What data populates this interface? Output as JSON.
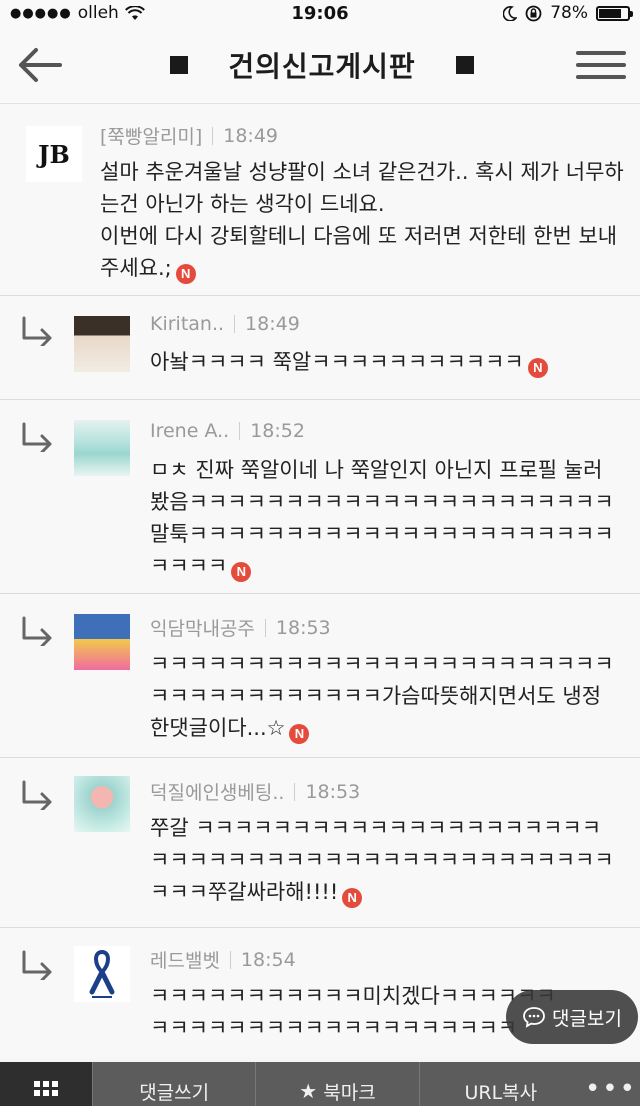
{
  "status_bar": {
    "carrier": "olleh",
    "time": "19:06",
    "battery": "78%",
    "battery_level": 0.78
  },
  "header": {
    "title": "건의신고게시판"
  },
  "comments": [
    {
      "author": "[쭉빵알리미]",
      "time": "18:49",
      "text": "설마 추운겨울날 성냥팔이 소녀 같은건가.. 혹시 제가 너무하는건 아닌가 하는 생각이 드네요.\n이번에 다시 강퇴할테니 다음에 또 저러면 저한테 한번 보내주세요.;",
      "badge": "N",
      "avatar_text": "JB"
    },
    {
      "author": "Kiritan..",
      "time": "18:49",
      "text": "아놬ㅋㅋㅋㅋ 쭉알ㅋㅋㅋㅋㅋㅋㅋㅋㅋㅋㅋ",
      "badge": "N"
    },
    {
      "author": "Irene A..",
      "time": "18:52",
      "text": "ㅁㅊ 진짜 쭉알이네 나 쭉알인지 아닌지 프로필 눌러봤음ㅋㅋㅋㅋㅋㅋㅋㅋㅋㅋㅋㅋㅋㅋㅋㅋㅋㅋㅋㅋㅋㅋ말툭ㅋㅋㅋㅋㅋㅋㅋㅋㅋㅋㅋㅋㅋㅋㅋㅋㅋㅋㅋㅋㅋㅋ ㅋㅋㅋㅋ",
      "badge": "N"
    },
    {
      "author": "익담막내공주",
      "time": "18:53",
      "text": "ㅋㅋㅋㅋㅋㅋㅋㅋㅋㅋㅋㅋㅋㅋㅋㅋㅋㅋㅋㅋㅋㅋㅋㅋㅋㅋㅋㅋㅋㅋㅋㅋㅋㅋㅋㅋ가슴따뜻해지면서도 냉정한댓글이다...☆",
      "badge": "N"
    },
    {
      "author": "덕질에인생베팅..",
      "time": "18:53",
      "text": "쭈갈 ㅋㅋㅋㅋㅋㅋㅋㅋㅋㅋㅋㅋㅋㅋㅋㅋㅋㅋㅋㅋㅋㅋㅋㅋㅋㅋㅋㅋㅋㅋㅋㅋㅋㅋㅋㅋㅋㅋㅋㅋㅋㅋㅋㅋㅋㅋㅋㅋ쭈갈싸라해!!!!",
      "badge": "N"
    },
    {
      "author": "레드밸벳",
      "time": "18:54",
      "text": "ㅋㅋㅋㅋㅋㅋㅋㅋㅋㅋㅋ미치겠다ㅋㅋㅋㅋㅋㅋ\nㅋㅋㅋㅋㅋㅋㅋㅋㅋㅋㅋㅋㅋㅋㅋㅋㅋㅋㅋ"
    }
  ],
  "float_button": {
    "label": "댓글보기"
  },
  "bottom_bar": {
    "items": [
      "댓글쓰기",
      "북마크",
      "URL복사"
    ],
    "more": "•••"
  },
  "icons": [
    "back-arrow-icon",
    "menu-icon",
    "reply-arrow-icon",
    "comment-bubble-icon",
    "grid-icon",
    "star-icon",
    "wifi-icon",
    "moon-icon",
    "rotation-lock-icon",
    "battery-icon"
  ],
  "colors": {
    "badge": "#e54b3c",
    "bottom_bar": "#5c5c5c",
    "float_button": "#373737"
  }
}
